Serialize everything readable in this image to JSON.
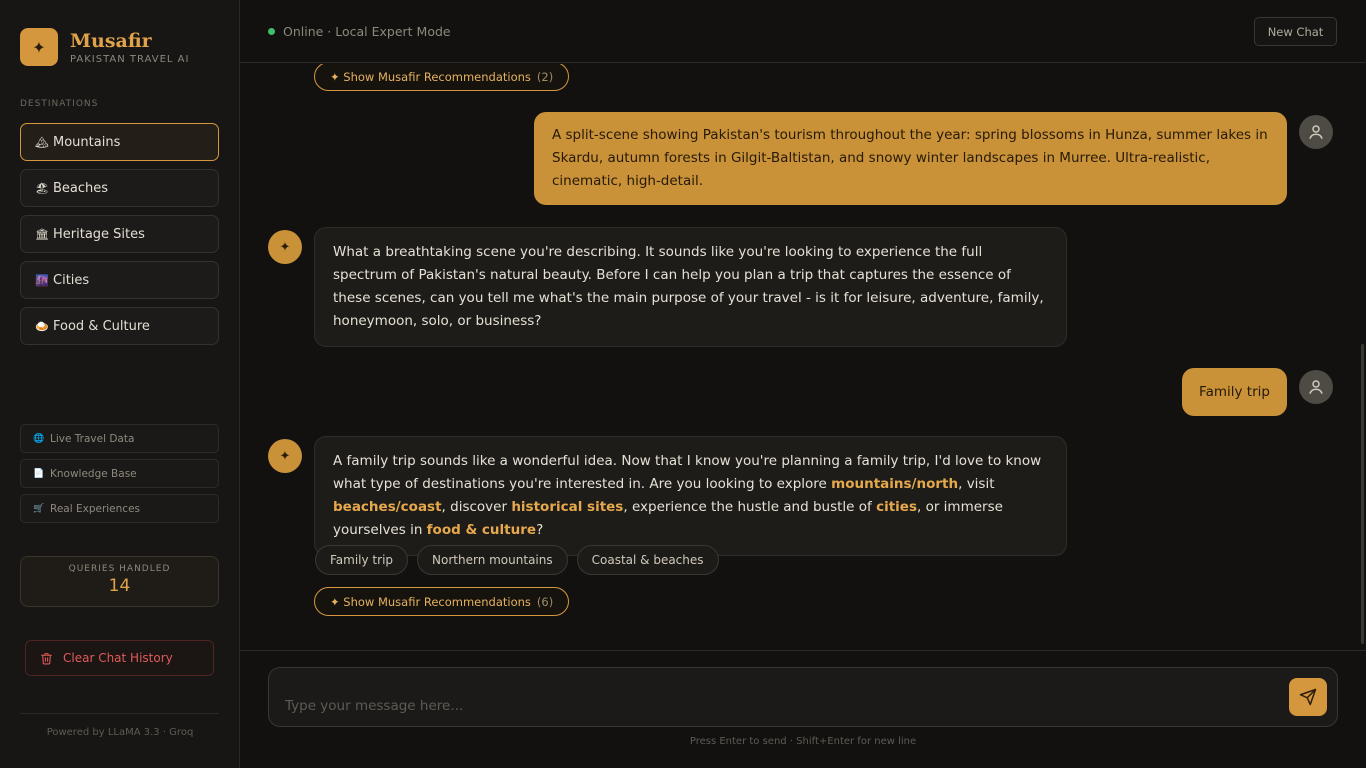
{
  "brand": {
    "logo_glyph": "✦",
    "name": "Musafir",
    "subtitle": "PAKISTAN TRAVEL AI"
  },
  "sidebar": {
    "section_label": "DESTINATIONS",
    "nav": [
      {
        "icon": "🏔",
        "label": "Mountains",
        "active": true
      },
      {
        "icon": "🏖",
        "label": "Beaches"
      },
      {
        "icon": "🏛",
        "label": "Heritage Sites"
      },
      {
        "icon": "🌆",
        "label": "Cities"
      },
      {
        "icon": "🍛",
        "label": "Food & Culture"
      }
    ],
    "features": [
      {
        "icon": "🌐",
        "label": "Live Travel Data"
      },
      {
        "icon": "📄",
        "label": "Knowledge Base"
      },
      {
        "icon": "🛒",
        "label": "Real Experiences"
      }
    ],
    "stats": {
      "label": "QUERIES HANDLED",
      "value": "14"
    },
    "clear_label": "Clear Chat History",
    "powered_by": "Powered by LLaMA 3.3 · Groq"
  },
  "topbar": {
    "status": "Online · Local Expert Mode",
    "new_chat": "New Chat"
  },
  "chat": {
    "rec_top": {
      "label": "✦ Show Musafir Recommendations",
      "count": "(2)"
    },
    "msg1_user": "A split-scene showing Pakistan's tourism throughout the year: spring blossoms in Hunza, summer lakes in Skardu, autumn forests in Gilgit-Baltistan, and snowy winter landscapes in Murree. Ultra-realistic, cinematic, high-detail.",
    "msg2_bot": "What a breathtaking scene you're describing. It sounds like you're looking to experience the full spectrum of Pakistan's natural beauty. Before I can help you plan a trip that captures the essence of these scenes, can you tell me what's the main purpose of your travel - is it for leisure, adventure, family, honeymoon, solo, or business?",
    "msg3_user": "Family trip",
    "msg4_bot": {
      "p1": "A family trip sounds like a wonderful idea. Now that I know you're planning a family trip, I'd love to know what type of destinations you're interested in. Are you looking to explore ",
      "h1": "mountains/north",
      "p2": ", visit ",
      "h2": "beaches/coast",
      "p3": ", discover ",
      "h3": "historical sites",
      "p4": ", experience the hustle and bustle of ",
      "h4": "cities",
      "p5": ", or immerse yourselves in ",
      "h5": "food & culture",
      "p6": "?"
    },
    "chips": [
      "Family trip",
      "Northern mountains",
      "Coastal & beaches"
    ],
    "rec_bottom": {
      "label": "✦ Show Musafir Recommendations",
      "count": "(6)"
    },
    "bot_avatar_glyph": "✦"
  },
  "composer": {
    "placeholder": "Type your message here...",
    "hint": "Press Enter to send · Shift+Enter for new line"
  },
  "colors": {
    "accent": "#d4973d",
    "online": "#3fbf6a",
    "danger": "#e05a57",
    "background": "#121110"
  }
}
